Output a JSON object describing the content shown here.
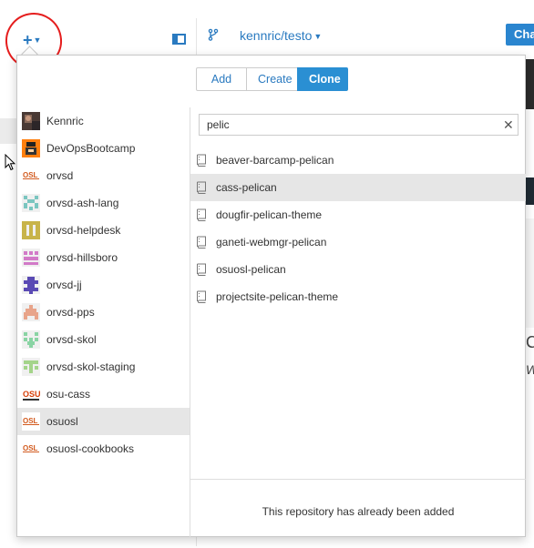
{
  "toolbar": {
    "add_menu_icon": "plus-icon",
    "repo_name": "kennric/testo",
    "changes_label": "Cha"
  },
  "background": {
    "text_c": "C",
    "text_w": "W"
  },
  "popover": {
    "tabs": [
      {
        "label": "Add",
        "active": false
      },
      {
        "label": "Create",
        "active": false
      },
      {
        "label": "Clone",
        "active": true
      }
    ],
    "orgs": [
      {
        "label": "Kennric",
        "avatar": "photo"
      },
      {
        "label": "DevOpsBootcamp",
        "avatar": "devops"
      },
      {
        "label": "orvsd",
        "avatar": "osl"
      },
      {
        "label": "orvsd-ash-lang",
        "avatar": "identicon-teal"
      },
      {
        "label": "orvsd-helpdesk",
        "avatar": "identicon-olive"
      },
      {
        "label": "orvsd-hillsboro",
        "avatar": "identicon-pink"
      },
      {
        "label": "orvsd-jj",
        "avatar": "identicon-purple"
      },
      {
        "label": "orvsd-pps",
        "avatar": "identicon-peach"
      },
      {
        "label": "orvsd-skol",
        "avatar": "identicon-green"
      },
      {
        "label": "orvsd-skol-staging",
        "avatar": "identicon-lime"
      },
      {
        "label": "osu-cass",
        "avatar": "osu"
      },
      {
        "label": "osuosl",
        "avatar": "osl",
        "selected": true
      },
      {
        "label": "osuosl-cookbooks",
        "avatar": "osl"
      }
    ],
    "search": {
      "value": "pelic"
    },
    "repos": [
      {
        "label": "beaver-barcamp-pelican"
      },
      {
        "label": "cass-pelican",
        "selected": true
      },
      {
        "label": "dougfir-pelican-theme"
      },
      {
        "label": "ganeti-webmgr-pelican"
      },
      {
        "label": "osuosl-pelican"
      },
      {
        "label": "projectsite-pelican-theme"
      }
    ],
    "footer_message": "This repository has already been added"
  },
  "colors": {
    "accent": "#2a8fd3",
    "link": "#2a7ac0",
    "annotation_circle": "#e51d1d",
    "selected_row": "#e6e6e6"
  }
}
